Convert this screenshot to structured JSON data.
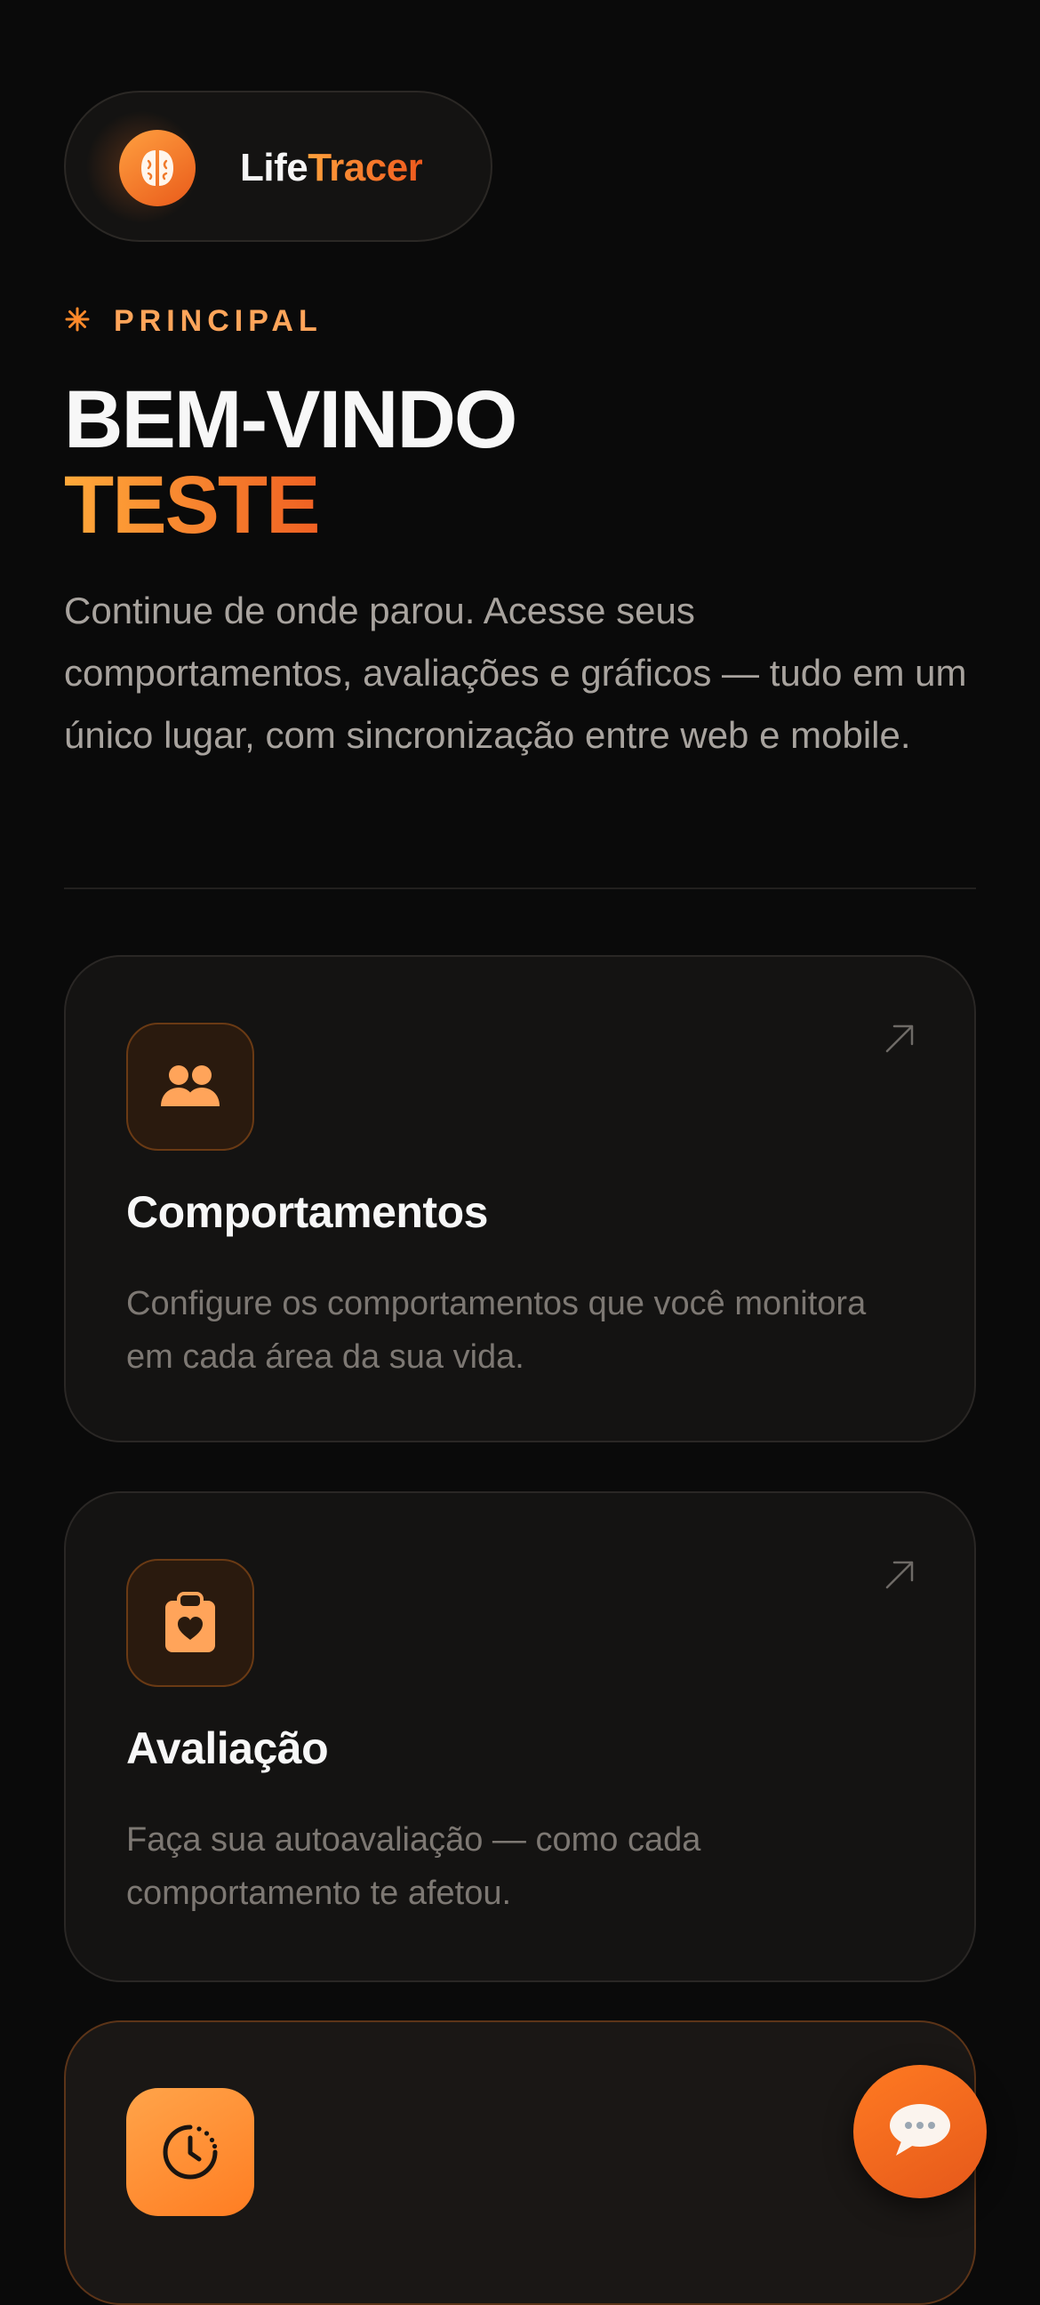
{
  "brand": {
    "name_part1": "Life",
    "name_part2": "Tracer",
    "logo_icon": "brain-icon"
  },
  "section": {
    "eyebrow_icon": "asterisk-icon",
    "eyebrow": "PRINCIPAL"
  },
  "heading": {
    "line1": "BEM-VINDO",
    "line2": "TESTE"
  },
  "intro": "Continue de onde parou. Acesse seus comportamentos, avaliações e gráficos — tudo em um único lugar, com sincronização entre web e mobile.",
  "cards": [
    {
      "icon": "users-icon",
      "title": "Comportamentos",
      "description": "Configure os comportamentos que você monitora em cada área da sua vida."
    },
    {
      "icon": "clipboard-heart-icon",
      "title": "Avaliação",
      "description": "Faça sua autoavaliação — como cada comportamento te afetou."
    },
    {
      "icon": "clock-history-icon"
    }
  ],
  "fab": {
    "icon": "chat-bubble-icon"
  },
  "colors": {
    "background": "#0a0a0a",
    "card": "#141312",
    "accent": "#ff7a22",
    "accent_light": "#ffa55a"
  }
}
